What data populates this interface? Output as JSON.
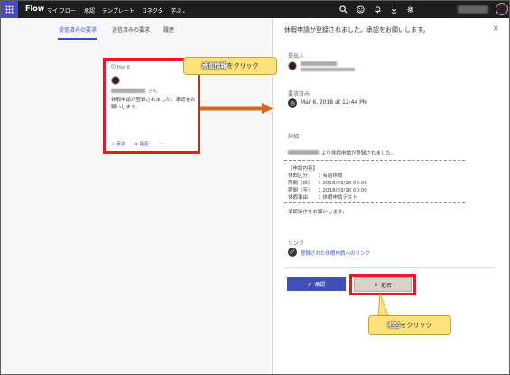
{
  "topbar": {
    "brand": "Flow",
    "nav": [
      "マイ フロー",
      "承認",
      "テンプレート",
      "コネクタ",
      "学ぶ"
    ],
    "learn_chevron": "⌄",
    "icons": [
      "search-icon",
      "smiley-icon",
      "bell-icon",
      "download-icon",
      "gear-icon",
      "avatar"
    ]
  },
  "tabs": [
    "受信済みの要求",
    "送信済みの要求",
    "履歴"
  ],
  "card": {
    "date": "Mar 8",
    "honorific": "さん",
    "body": "休暇申請が登録されました。承認をお願いします。",
    "approve": "承認",
    "reject": "拒否",
    "more": "···"
  },
  "callouts": {
    "card_em": "承認情報",
    "card_rest": "をクリック",
    "reject_em": "拒否",
    "reject_rest": "をクリック"
  },
  "panel": {
    "title": "休暇申請が登録されました。承認をお願いします。",
    "requester_label": "提出人",
    "requested_label": "要求済み",
    "requested_date": "Mar 8, 2018 at 12:44 PM",
    "details_label": "詳細",
    "details_line1": "より休暇申請が登録されました。",
    "details_header": "【申請内容】",
    "details_rows": [
      {
        "key": "休暇区分",
        "val": "：有給休暇"
      },
      {
        "key": "期間（自）",
        "val": "：2018/03/16 00:00"
      },
      {
        "key": "期間（至）",
        "val": "：2018/03/16 00:00"
      },
      {
        "key": "休暇事由",
        "val": "：休暇申請テスト"
      }
    ],
    "details_footer": "承認操作をお願いします。",
    "link_label": "リンク",
    "link_text": "登録された休暇申請へのリンク",
    "approve_btn": "承認",
    "reject_btn": "拒否"
  },
  "colors": {
    "accent": "#4051b5",
    "highlight": "#e01f22",
    "callout": "#ffe27a",
    "arrow": "#d2691e"
  }
}
